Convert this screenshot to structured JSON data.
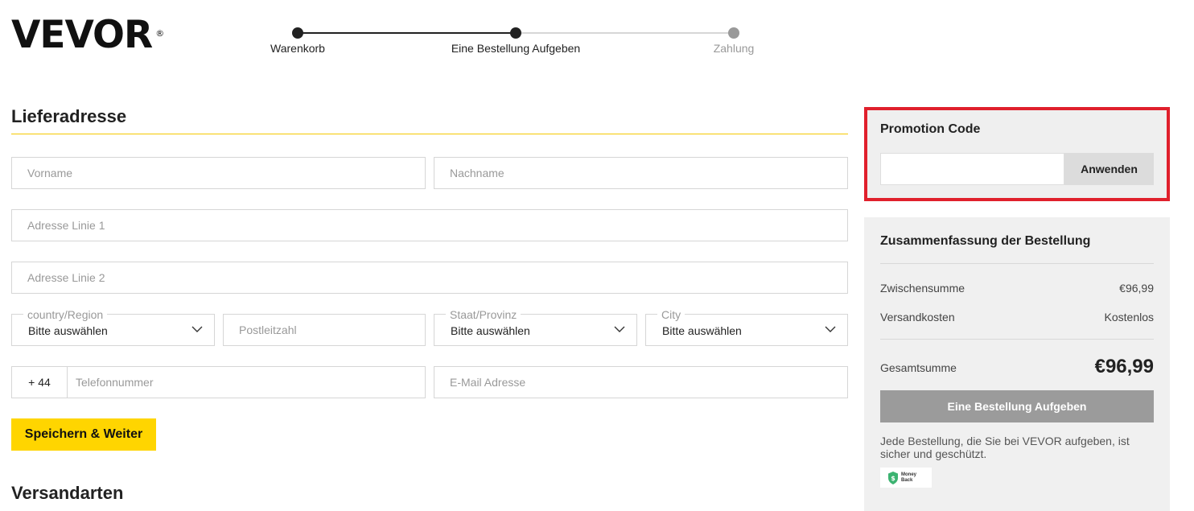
{
  "header": {
    "logo": "VEVOR",
    "logo_mark": "®",
    "steps": [
      {
        "label": "Warenkorb",
        "state": "done"
      },
      {
        "label": "Eine Bestellung Aufgeben",
        "state": "current"
      },
      {
        "label": "Zahlung",
        "state": "upcoming"
      }
    ]
  },
  "shipping": {
    "title": "Lieferadresse",
    "first_name_placeholder": "Vorname",
    "last_name_placeholder": "Nachname",
    "address1_placeholder": "Adresse Linie 1",
    "address2_placeholder": "Adresse Linie 2",
    "country_label": "country/Region",
    "country_value": "Bitte auswählen",
    "postcode_placeholder": "Postleitzahl",
    "state_label": "Staat/Provinz",
    "state_value": "Bitte auswählen",
    "city_label": "City",
    "city_value": "Bitte auswählen",
    "phone_prefix": "+ 44",
    "phone_placeholder": "Telefonnummer",
    "email_placeholder": "E-Mail Adresse",
    "save_label": "Speichern & Weiter"
  },
  "shipping_methods": {
    "title": "Versandarten"
  },
  "promo": {
    "title": "Promotion Code",
    "apply_label": "Anwenden",
    "highlight_color": "#e0202c"
  },
  "summary": {
    "title": "Zusammenfassung der Bestellung",
    "subtotal_label": "Zwischensumme",
    "subtotal_value": "€96,99",
    "shipping_label": "Versandkosten",
    "shipping_value": "Kostenlos",
    "total_label": "Gesamtsumme",
    "total_value": "€96,99",
    "place_order_label": "Eine Bestellung Aufgeben",
    "secure_note": "Jede Bestellung, die Sie bei VEVOR aufgeben, ist sicher und geschützt.",
    "badge_line1": "Money",
    "badge_line2": "Back"
  },
  "colors": {
    "accent_yellow": "#ffd500",
    "step_done": "#222222",
    "step_upcoming": "#999999"
  }
}
